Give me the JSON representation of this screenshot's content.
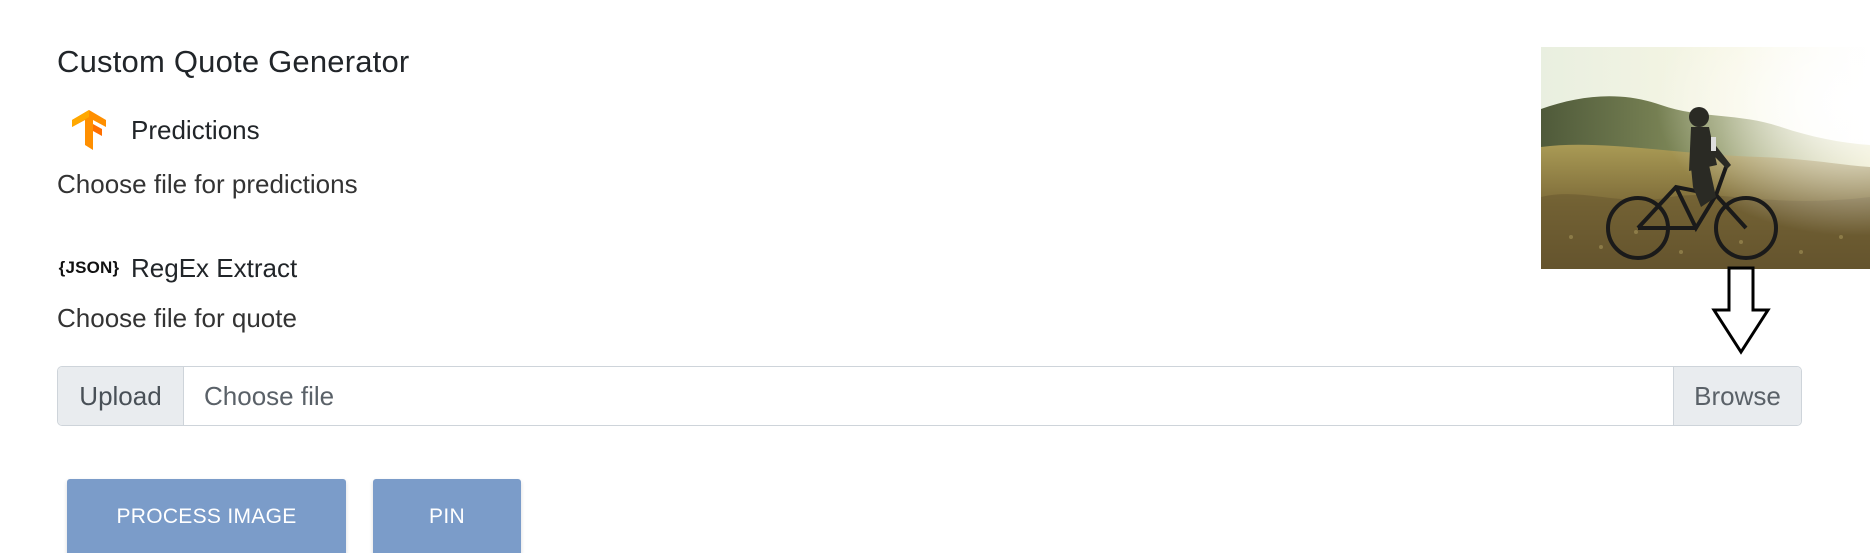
{
  "app": {
    "title": "Custom Quote Generator"
  },
  "predictions": {
    "icon": "tensorflow-icon",
    "label": "Predictions",
    "choose_text": "Choose file for predictions"
  },
  "regex": {
    "icon": "json-icon",
    "icon_text": "{JSON}",
    "label": "RegEx Extract",
    "choose_text": "Choose file for quote"
  },
  "file_upload": {
    "upload_label": "Upload",
    "placeholder": "Choose file",
    "browse_label": "Browse"
  },
  "actions": {
    "process_label": "PROCESS IMAGE",
    "pin_label": "PIN"
  },
  "colors": {
    "button_bg": "#7b9cc9",
    "tensorflow_orange": "#ff8f00",
    "input_border": "#ced4da",
    "addon_bg": "#e9ecef"
  },
  "preview_image": {
    "subject": "cyclist-on-mountain-bike-photo"
  },
  "annotation": {
    "icon": "down-arrow-icon"
  }
}
